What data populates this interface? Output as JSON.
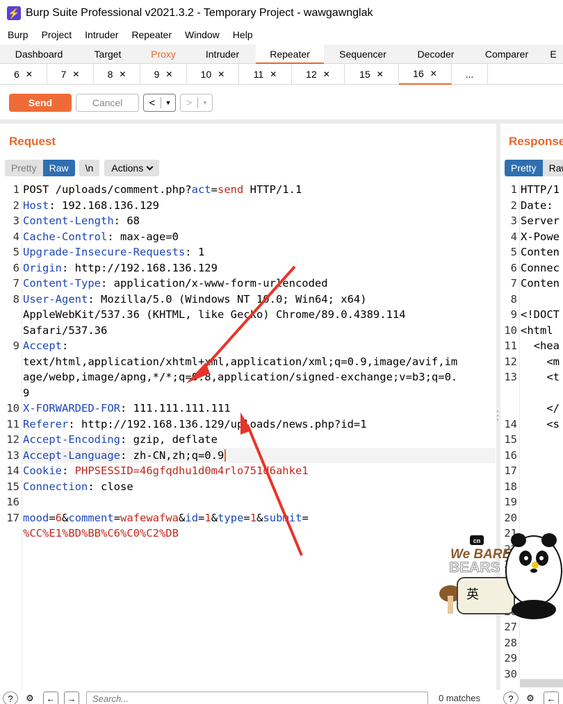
{
  "window": {
    "title": "Burp Suite Professional v2021.3.2 - Temporary Project - wawgawnglak",
    "icon": "burp-lightning-icon"
  },
  "menu": [
    "Burp",
    "Project",
    "Intruder",
    "Repeater",
    "Window",
    "Help"
  ],
  "tool_tabs": [
    {
      "label": "Dashboard"
    },
    {
      "label": "Target"
    },
    {
      "label": "Proxy"
    },
    {
      "label": "Intruder"
    },
    {
      "label": "Repeater",
      "active": true
    },
    {
      "label": "Sequencer"
    },
    {
      "label": "Decoder"
    },
    {
      "label": "Comparer"
    },
    {
      "label": "E"
    }
  ],
  "request_tabs": [
    {
      "label": "6"
    },
    {
      "label": "7"
    },
    {
      "label": "8"
    },
    {
      "label": "9"
    },
    {
      "label": "10"
    },
    {
      "label": "11"
    },
    {
      "label": "12"
    },
    {
      "label": "15"
    },
    {
      "label": "16",
      "active": true
    },
    {
      "label": "..."
    }
  ],
  "actions": {
    "send": "Send",
    "cancel": "Cancel",
    "back": "<",
    "forward": ">"
  },
  "request_panel": {
    "title": "Request",
    "views": {
      "pretty": "Pretty",
      "raw": "Raw",
      "newline": "\\n",
      "actions": "Actions"
    },
    "lines": [
      {
        "n": "1",
        "segs": [
          [
            "POST /uploads/comment.php?",
            "val"
          ],
          [
            "act",
            "blue"
          ],
          [
            "=",
            "val"
          ],
          [
            "send",
            "red"
          ],
          [
            " HTTP/1.1",
            "val"
          ]
        ]
      },
      {
        "n": "2",
        "segs": [
          [
            "Host",
            "hdr"
          ],
          [
            ": 192.168.136.129",
            "val"
          ]
        ]
      },
      {
        "n": "3",
        "segs": [
          [
            "Content-Length",
            "hdr"
          ],
          [
            ": 68",
            "val"
          ]
        ]
      },
      {
        "n": "4",
        "segs": [
          [
            "Cache-Control",
            "hdr"
          ],
          [
            ": max-age=0",
            "val"
          ]
        ]
      },
      {
        "n": "5",
        "segs": [
          [
            "Upgrade-Insecure-Requests",
            "hdr"
          ],
          [
            ": 1",
            "val"
          ]
        ]
      },
      {
        "n": "6",
        "segs": [
          [
            "Origin",
            "hdr"
          ],
          [
            ": http://192.168.136.129",
            "val"
          ]
        ]
      },
      {
        "n": "7",
        "segs": [
          [
            "Content-Type",
            "hdr"
          ],
          [
            ": application/x-www-form-urlencoded",
            "val"
          ]
        ]
      },
      {
        "n": "8",
        "segs": [
          [
            "User-Agent",
            "hdr"
          ],
          [
            ": Mozilla/5.0 (Windows NT 10.0; Win64; x64)",
            "val"
          ]
        ]
      },
      {
        "n": "",
        "segs": [
          [
            "AppleWebKit/537.36 (KHTML, like Gecko) Chrome/89.0.4389.114",
            "val"
          ]
        ]
      },
      {
        "n": "",
        "segs": [
          [
            "Safari/537.36",
            "val"
          ]
        ]
      },
      {
        "n": "9",
        "segs": [
          [
            "Accept",
            "hdr"
          ],
          [
            ":",
            "val"
          ]
        ]
      },
      {
        "n": "",
        "segs": [
          [
            "text/html,application/xhtml+xml,application/xml;q=0.9,image/avif,im",
            "val"
          ]
        ]
      },
      {
        "n": "",
        "segs": [
          [
            "age/webp,image/apng,*/*;q=0.8,application/signed-exchange;v=b3;q=0.",
            "val"
          ]
        ]
      },
      {
        "n": "",
        "segs": [
          [
            "9",
            "val"
          ]
        ]
      },
      {
        "n": "10",
        "segs": [
          [
            "X-FORWARDED-FOR",
            "hdr"
          ],
          [
            ": 111.111.111.111",
            "val"
          ]
        ]
      },
      {
        "n": "11",
        "segs": [
          [
            "Referer",
            "hdr"
          ],
          [
            ": http://192.168.136.129/uploads/news.php?id=1",
            "val"
          ]
        ]
      },
      {
        "n": "12",
        "segs": [
          [
            "Accept-Encoding",
            "hdr"
          ],
          [
            ": gzip, deflate",
            "val"
          ]
        ]
      },
      {
        "n": "13",
        "segs": [
          [
            "Accept-Language",
            "hdr"
          ],
          [
            ": zh-CN,zh;q=0.9",
            "val"
          ]
        ],
        "current": true
      },
      {
        "n": "14",
        "segs": [
          [
            "Cookie",
            "hdr"
          ],
          [
            ": ",
            "val"
          ],
          [
            "PHPSESSID",
            "red"
          ],
          [
            "=46gfqdhu1d0m4rlo751d6ahke1",
            "red"
          ]
        ]
      },
      {
        "n": "15",
        "segs": [
          [
            "Connection",
            "hdr"
          ],
          [
            ": close",
            "val"
          ]
        ]
      },
      {
        "n": "16",
        "segs": []
      },
      {
        "n": "17",
        "segs": [
          [
            "mood",
            "blue"
          ],
          [
            "=",
            "val"
          ],
          [
            "6",
            "red"
          ],
          [
            "&",
            "val"
          ],
          [
            "comment",
            "blue"
          ],
          [
            "=",
            "val"
          ],
          [
            "wafewafwa",
            "red"
          ],
          [
            "&",
            "val"
          ],
          [
            "id",
            "blue"
          ],
          [
            "=",
            "val"
          ],
          [
            "1",
            "red"
          ],
          [
            "&",
            "val"
          ],
          [
            "type",
            "blue"
          ],
          [
            "=",
            "val"
          ],
          [
            "1",
            "red"
          ],
          [
            "&",
            "val"
          ],
          [
            "submit",
            "blue"
          ],
          [
            "=",
            "val"
          ]
        ]
      },
      {
        "n": "",
        "segs": [
          [
            "%CC%E1%BD%BB%C6%C0%C2%DB",
            "red"
          ]
        ]
      }
    ]
  },
  "response_panel": {
    "title": "Response",
    "views": {
      "pretty": "Pretty",
      "raw": "Raw"
    },
    "lines": [
      {
        "n": "1",
        "t": "HTTP/1"
      },
      {
        "n": "2",
        "t": "Date:"
      },
      {
        "n": "3",
        "t": "Server"
      },
      {
        "n": "4",
        "t": "X-Powe"
      },
      {
        "n": "5",
        "t": "Conten"
      },
      {
        "n": "6",
        "t": "Connec"
      },
      {
        "n": "7",
        "t": "Conten"
      },
      {
        "n": "8",
        "t": ""
      },
      {
        "n": "9",
        "t": "<!DOCT"
      },
      {
        "n": "10",
        "t": "<html"
      },
      {
        "n": "11",
        "t": "  <hea"
      },
      {
        "n": "12",
        "t": "    <m"
      },
      {
        "n": "13",
        "t": "    <t"
      },
      {
        "n": "",
        "t": ""
      },
      {
        "n": "",
        "t": "    </"
      },
      {
        "n": "14",
        "t": "    <s"
      },
      {
        "n": "15",
        "t": ""
      },
      {
        "n": "16",
        "t": ""
      },
      {
        "n": "17",
        "t": ""
      },
      {
        "n": "18",
        "t": ""
      },
      {
        "n": "19",
        "t": ""
      },
      {
        "n": "20",
        "t": ""
      },
      {
        "n": "21",
        "t": ""
      },
      {
        "n": "22",
        "t": ""
      },
      {
        "n": "23",
        "t": ""
      },
      {
        "n": "24",
        "t": ""
      },
      {
        "n": "25",
        "t": ""
      },
      {
        "n": "26",
        "t": ""
      },
      {
        "n": "27",
        "t": ""
      },
      {
        "n": "28",
        "t": ""
      },
      {
        "n": "29",
        "t": ""
      },
      {
        "n": "30",
        "t": ""
      }
    ]
  },
  "sticker": {
    "brand": "cn",
    "line1": "We BARE",
    "line2": "BEARS",
    "ime": "英"
  },
  "search": {
    "placeholder": "Search...",
    "matches": "0 matches"
  },
  "colors": {
    "accent": "#e8682c",
    "selected_view": "#2f6fb0",
    "header_name": "#1d47b8",
    "param_value": "#c1271e",
    "annotation_arrow": "#e8342a"
  }
}
